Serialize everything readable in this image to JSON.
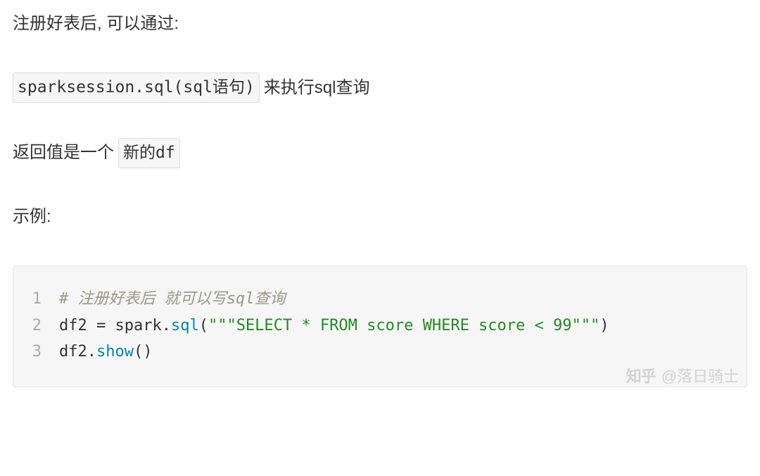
{
  "para1": "注册好表后, 可以通过:",
  "para2": {
    "code": "sparksession.sql(sql语句)",
    "suffix": "来执行sql查询"
  },
  "para3": {
    "prefix": "返回值是一个",
    "code": "新的df"
  },
  "para4": "示例:",
  "code_block": {
    "lines": [
      {
        "num": "1",
        "seg0": "# 注册好表后 就可以写sql查询"
      },
      {
        "num": "2",
        "seg0": "df2 = spark.",
        "seg1": "sql",
        "seg2": "(",
        "seg3": "\"\"\"SELECT * FROM score WHERE score < 99\"\"\"",
        "seg4": ")"
      },
      {
        "num": "3",
        "seg0": "df2.",
        "seg1": "show",
        "seg2": "()"
      }
    ]
  },
  "watermark": {
    "logo": "知乎",
    "handle": "@落日骑士"
  }
}
